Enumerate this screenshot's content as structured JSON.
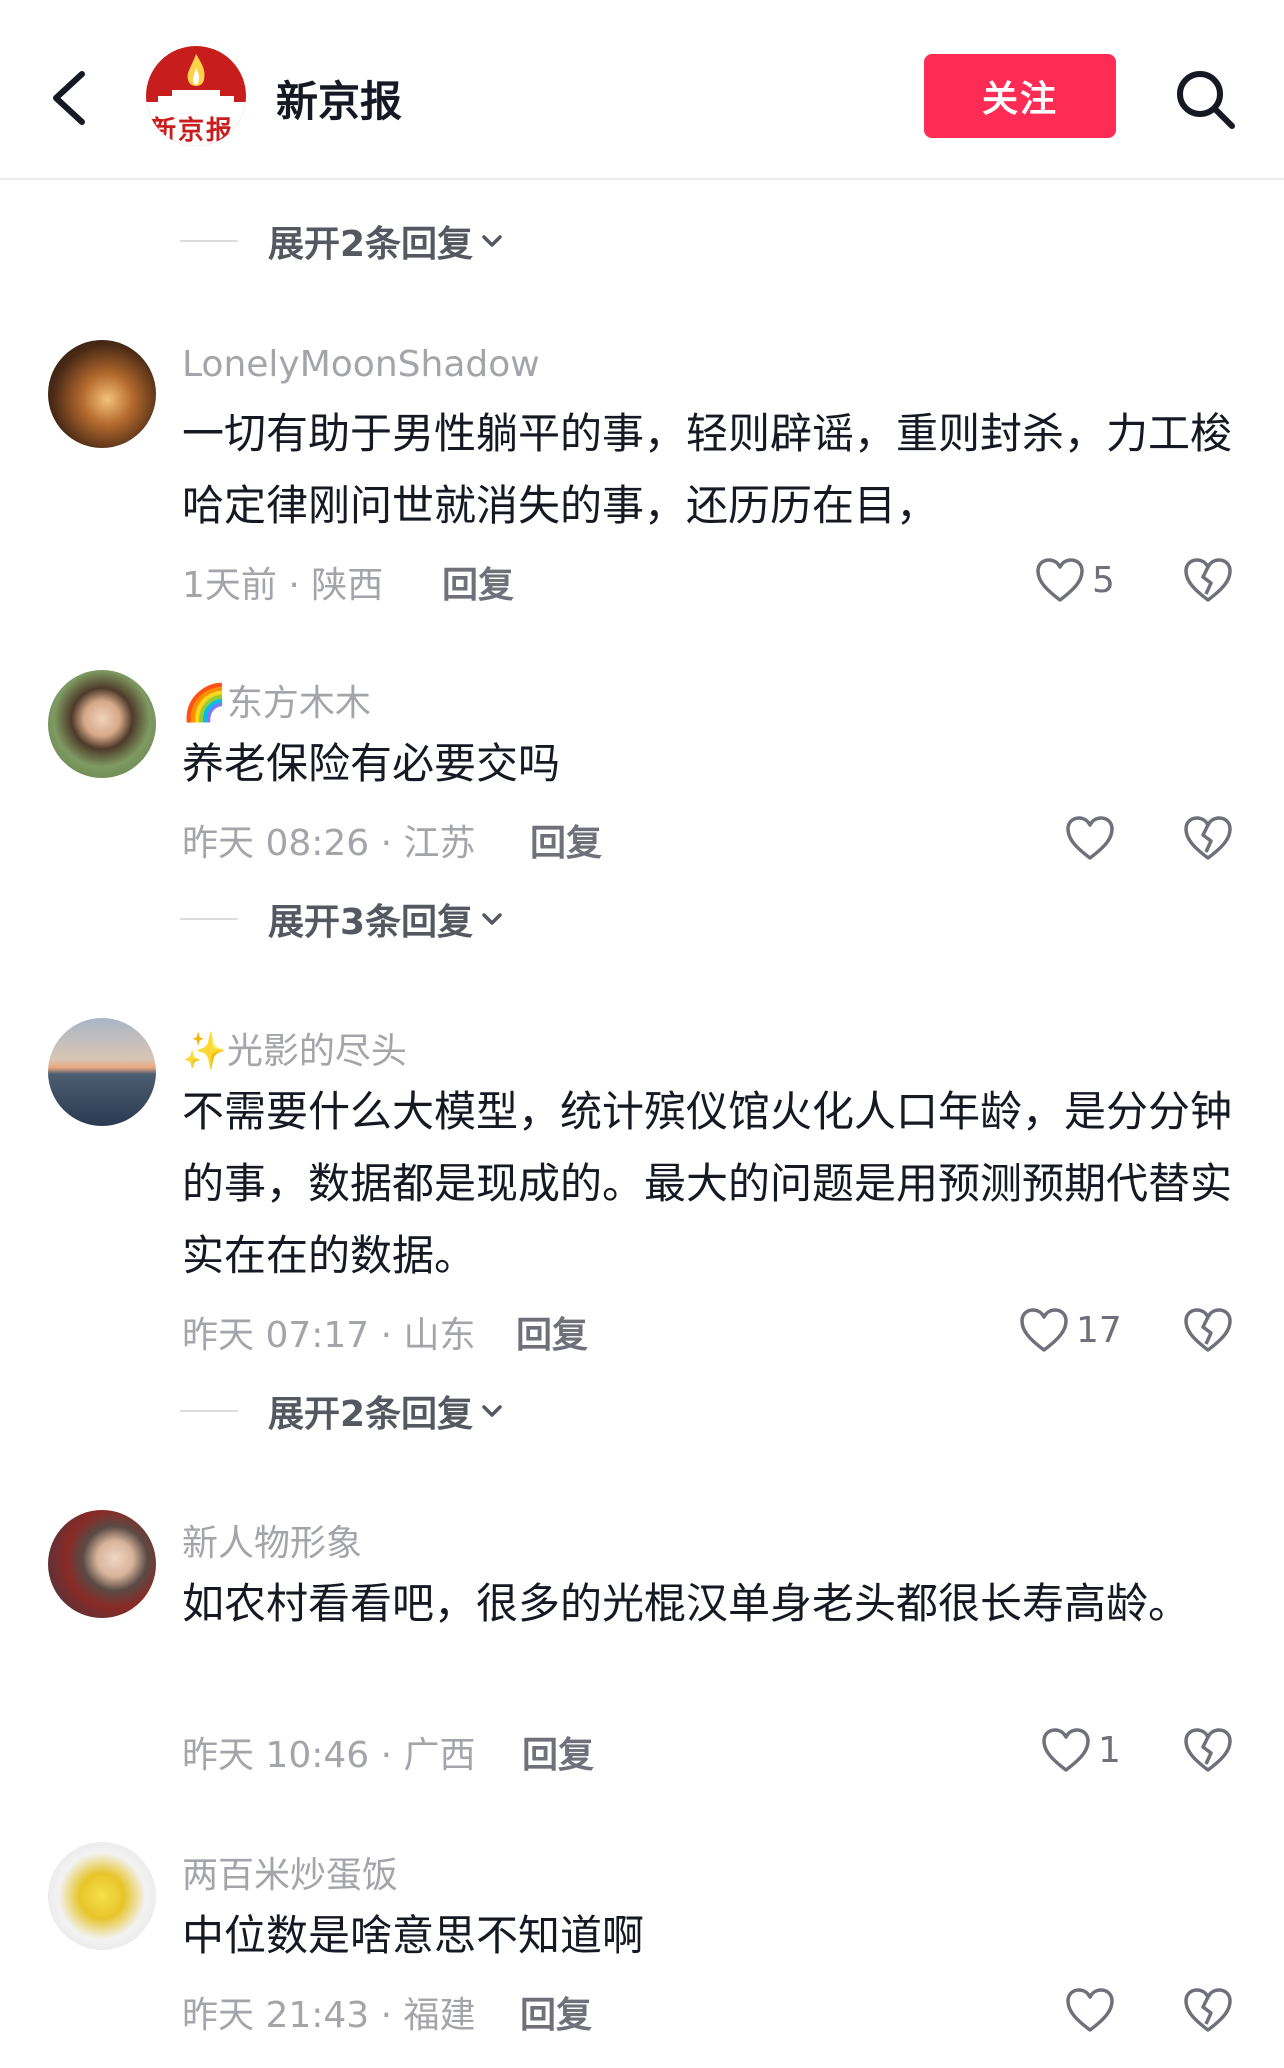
{
  "header": {
    "back_icon": "chevron-left-icon",
    "logo_text": "新京报",
    "account_name": "新京报",
    "follow_label": "关注",
    "search_icon": "search-icon"
  },
  "comments": [
    {
      "expand_label": "展开2条回复"
    },
    {
      "username": "LonelyMoonShadow",
      "text": "一切有助于男性躺平的事，轻则辟谣，重则封杀，力工梭哈定律刚问世就消失的事，还历历在目，",
      "meta": "1天前 · 陕西",
      "reply_label": "回复",
      "likes": "5"
    },
    {
      "username_prefix": "🌈",
      "username": "东方木木",
      "text": "养老保险有必要交吗",
      "meta": "昨天 08:26 · 江苏",
      "reply_label": "回复",
      "likes": "",
      "expand_label": "展开3条回复"
    },
    {
      "username_prefix": "✨",
      "username": "光影的尽头",
      "text": "不需要什么大模型，统计殡仪馆火化人口年龄，是分分钟的事，数据都是现成的。最大的问题是用预测预期代替实实在在的数据。",
      "meta": "昨天 07:17 · 山东",
      "reply_label": "回复",
      "likes": "17",
      "expand_label": "展开2条回复"
    },
    {
      "username": "新人物形象",
      "text": "如农村看看吧，很多的光棍汉单身老头都很长寿高龄。",
      "meta": "昨天 10:46 · 广西",
      "reply_label": "回复",
      "likes": "1"
    },
    {
      "username": "两百米炒蛋饭",
      "text": "中位数是啥意思不知道啊",
      "meta": "昨天 21:43 · 福建",
      "reply_label": "回复",
      "likes": ""
    }
  ],
  "icons": {
    "like": "heart-outline-icon",
    "dislike": "broken-heart-icon",
    "expand": "chevron-down-icon"
  },
  "colors": {
    "follow_button": "#fe2c55",
    "logo_red": "#c81d1d",
    "secondary_text": "#a4a5aa"
  }
}
